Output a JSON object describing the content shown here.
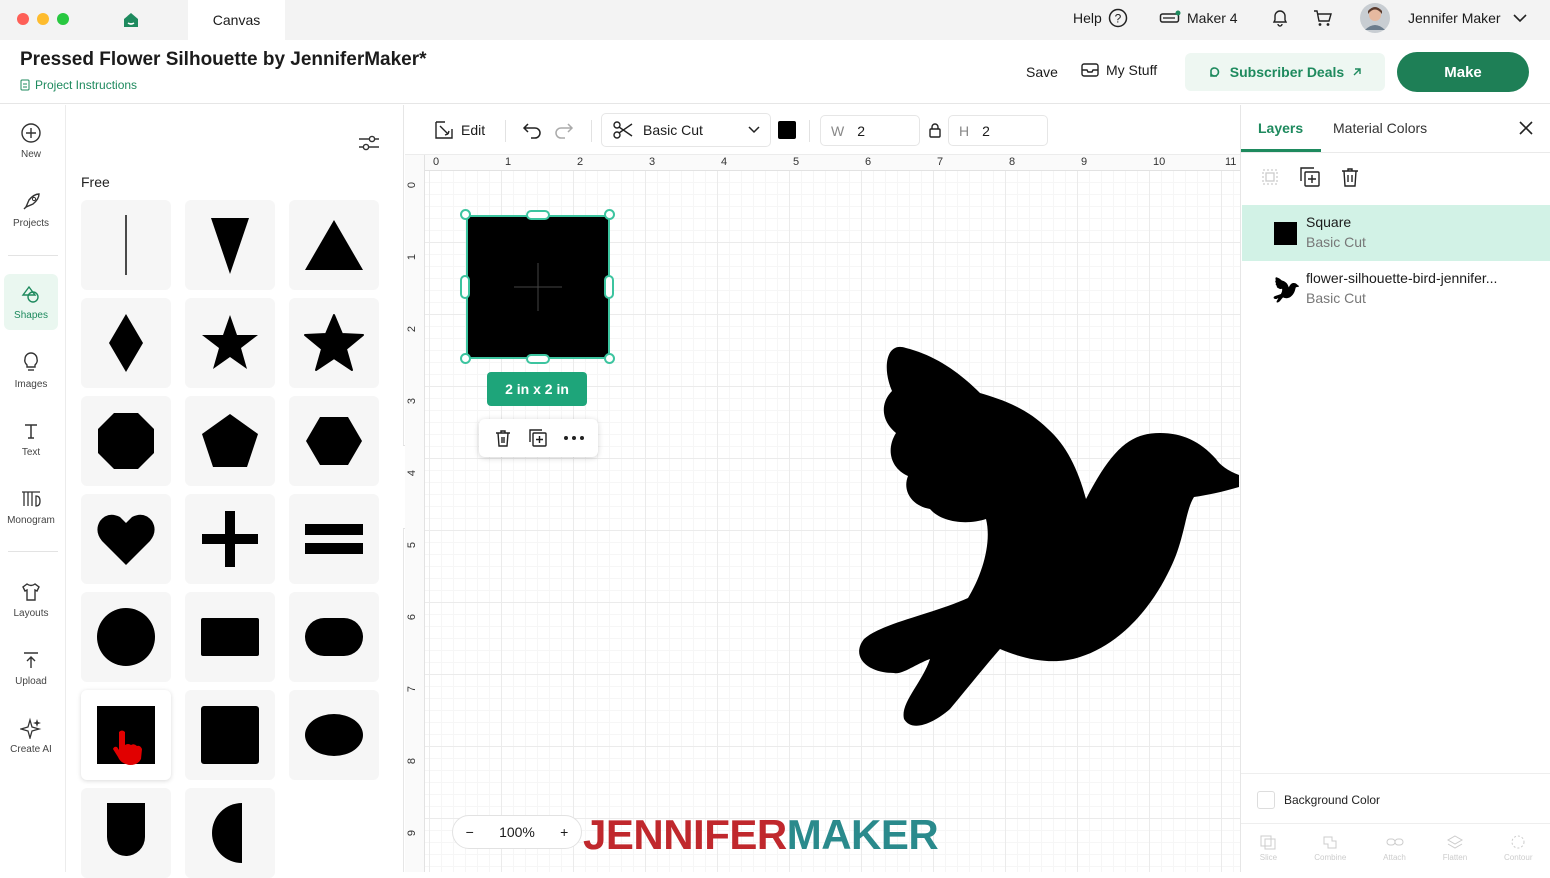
{
  "window": {
    "tab_title": "Canvas"
  },
  "topbar": {
    "help_label": "Help",
    "machine_label": "Maker 4",
    "user_name": "Jennifer Maker"
  },
  "header": {
    "project_title": "Pressed Flower Silhouette by JenniferMaker*",
    "project_instructions": "Project Instructions",
    "save_label": "Save",
    "mystuff_label": "My Stuff",
    "deals_label": "Subscriber Deals",
    "make_label": "Make"
  },
  "leftnav": {
    "items": [
      {
        "label": "New",
        "icon": "plus-circle-icon"
      },
      {
        "label": "Projects",
        "icon": "rocket-icon"
      },
      {
        "label": "Shapes",
        "icon": "shapes-icon",
        "active": true
      },
      {
        "label": "Images",
        "icon": "lightbulb-icon"
      },
      {
        "label": "Text",
        "icon": "text-icon"
      },
      {
        "label": "Monogram",
        "icon": "monogram-icon"
      },
      {
        "label": "Layouts",
        "icon": "tshirt-icon"
      },
      {
        "label": "Upload",
        "icon": "upload-icon"
      },
      {
        "label": "Create AI",
        "icon": "sparkle-icon"
      }
    ]
  },
  "shapes_panel": {
    "section_label": "Free",
    "shapes": [
      "line",
      "triangle-down",
      "triangle",
      "diamond",
      "star-5",
      "star-5-bold",
      "octagon",
      "pentagon",
      "hexagon",
      "heart",
      "plus",
      "equals",
      "circle",
      "rectangle",
      "rounded-rectangle",
      "square-selected",
      "square",
      "ellipse",
      "shield",
      "half-circle"
    ]
  },
  "toolbar": {
    "edit_label": "Edit",
    "operation_label": "Basic Cut",
    "color_chip": "#000000",
    "w_label": "W",
    "w_value": "2",
    "h_label": "H",
    "h_value": "2"
  },
  "canvas": {
    "ruler_x": [
      "0",
      "1",
      "2",
      "3",
      "4",
      "5",
      "6",
      "7",
      "8",
      "9",
      "10",
      "11"
    ],
    "ruler_y": [
      "0",
      "1",
      "2",
      "3",
      "4",
      "5",
      "6",
      "7",
      "8",
      "9"
    ],
    "size_badge": "2 in x 2 in",
    "zoom_value": "100%",
    "watermark_part1": "JENNIFER",
    "watermark_part2": "MAKER",
    "watermark_colors": [
      "#c0282d",
      "#2a8a8c"
    ]
  },
  "right_panel": {
    "tabs": [
      "Layers",
      "Material Colors"
    ],
    "layers": [
      {
        "name": "Square",
        "op": "Basic Cut",
        "selected": true
      },
      {
        "name": "flower-silhouette-bird-jennifer...",
        "op": "Basic Cut",
        "selected": false
      }
    ],
    "background_color_label": "Background Color",
    "bottom_tools": [
      "Slice",
      "Combine",
      "Attach",
      "Flatten",
      "Contour"
    ]
  },
  "colors": {
    "accent": "#1e8a5e",
    "make_button": "#1e7f56",
    "selection": "#3cc49f",
    "selected_layer": "#d2f2e6"
  }
}
